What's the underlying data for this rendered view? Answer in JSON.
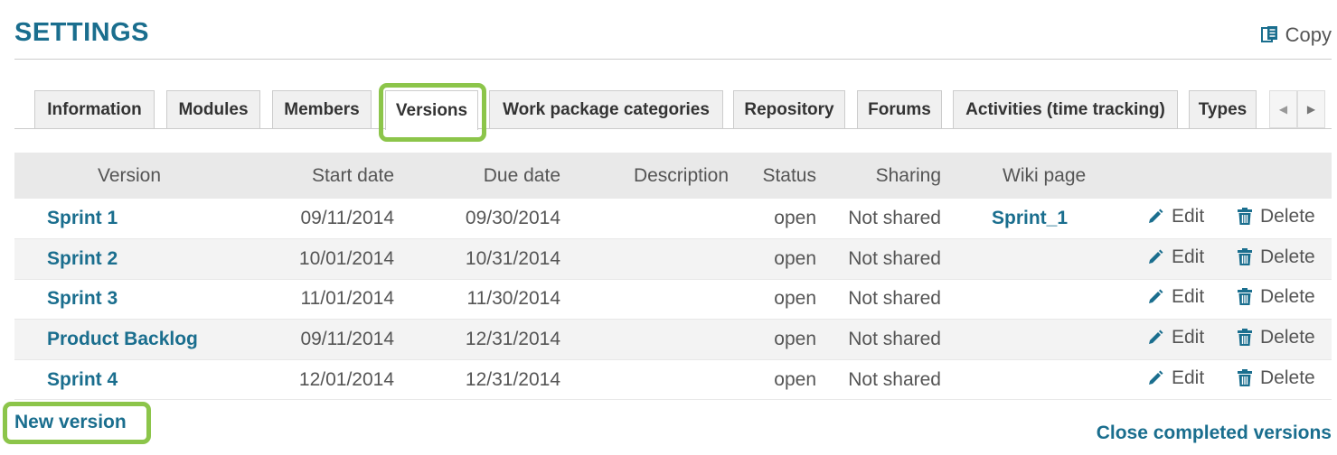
{
  "header": {
    "title": "SETTINGS",
    "copy_label": "Copy"
  },
  "tabs": [
    {
      "label": "Information",
      "active": false
    },
    {
      "label": "Modules",
      "active": false
    },
    {
      "label": "Members",
      "active": false
    },
    {
      "label": "Versions",
      "active": true
    },
    {
      "label": "Work package categories",
      "active": false
    },
    {
      "label": "Repository",
      "active": false
    },
    {
      "label": "Forums",
      "active": false
    },
    {
      "label": "Activities (time tracking)",
      "active": false
    },
    {
      "label": "Types",
      "active": false
    }
  ],
  "table": {
    "columns": [
      "Version",
      "Start date",
      "Due date",
      "Description",
      "Status",
      "Sharing",
      "Wiki page"
    ],
    "rows": [
      {
        "version": "Sprint 1",
        "start": "09/11/2014",
        "due": "09/30/2014",
        "description": "",
        "status": "open",
        "sharing": "Not shared",
        "wiki": "Sprint_1",
        "edit": "Edit",
        "delete": "Delete"
      },
      {
        "version": "Sprint 2",
        "start": "10/01/2014",
        "due": "10/31/2014",
        "description": "",
        "status": "open",
        "sharing": "Not shared",
        "wiki": "",
        "edit": "Edit",
        "delete": "Delete"
      },
      {
        "version": "Sprint 3",
        "start": "11/01/2014",
        "due": "11/30/2014",
        "description": "",
        "status": "open",
        "sharing": "Not shared",
        "wiki": "",
        "edit": "Edit",
        "delete": "Delete"
      },
      {
        "version": "Product Backlog",
        "start": "09/11/2014",
        "due": "12/31/2014",
        "description": "",
        "status": "open",
        "sharing": "Not shared",
        "wiki": "",
        "edit": "Edit",
        "delete": "Delete"
      },
      {
        "version": "Sprint 4",
        "start": "12/01/2014",
        "due": "12/31/2014",
        "description": "",
        "status": "open",
        "sharing": "Not shared",
        "wiki": "",
        "edit": "Edit",
        "delete": "Delete"
      }
    ]
  },
  "footer": {
    "new_version": "New version",
    "close_completed": "Close completed versions"
  },
  "colors": {
    "accent": "#1a6e8e",
    "highlight": "#8cc54a",
    "header_bg": "#e9e9e9"
  }
}
